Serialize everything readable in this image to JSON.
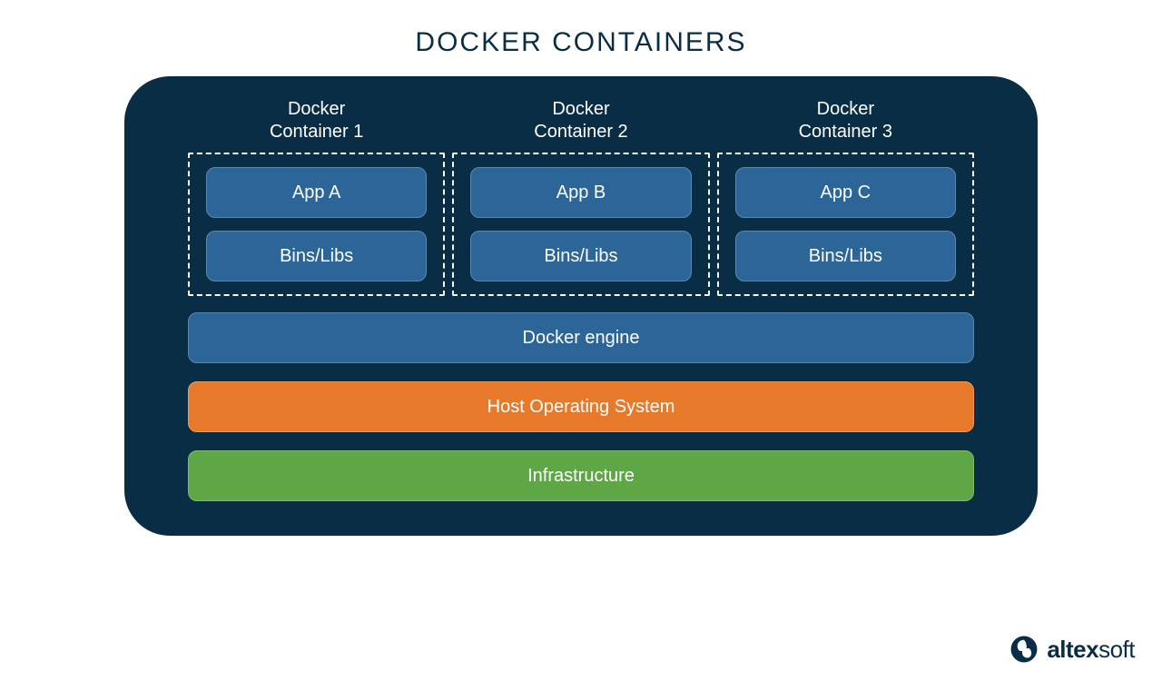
{
  "title": "DOCKER CONTAINERS",
  "containers": [
    {
      "label": "Docker\nContainer 1",
      "app": "App A",
      "bins": "Bins/Libs"
    },
    {
      "label": "Docker\nContainer 2",
      "app": "App B",
      "bins": "Bins/Libs"
    },
    {
      "label": "Docker\nContainer 3",
      "app": "App C",
      "bins": "Bins/Libs"
    }
  ],
  "layers": {
    "engine": "Docker engine",
    "host": "Host Operating System",
    "infra": "Infrastructure"
  },
  "brand": {
    "name_bold": "altex",
    "name_light": "soft"
  },
  "colors": {
    "panel": "#0a2d46",
    "blue": "#2c6699",
    "orange": "#e77a2a",
    "green": "#5fa647"
  }
}
